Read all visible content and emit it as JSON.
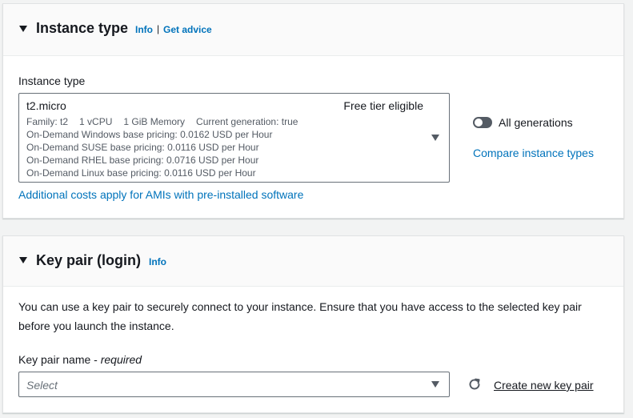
{
  "instance_type_section": {
    "title": "Instance type",
    "info_label": "Info",
    "separator": "|",
    "get_advice_label": "Get advice",
    "field_label": "Instance type",
    "selected": {
      "name": "t2.micro",
      "badge": "Free tier eligible",
      "family": "Family: t2",
      "vcpu": "1 vCPU",
      "memory": "1 GiB Memory",
      "generation": "Current generation: true",
      "pricing": [
        "On-Demand Windows base pricing: 0.0162 USD per Hour",
        "On-Demand SUSE base pricing: 0.0116 USD per Hour",
        "On-Demand RHEL base pricing: 0.0716 USD per Hour",
        "On-Demand Linux base pricing: 0.0116 USD per Hour"
      ]
    },
    "all_generations_label": "All generations",
    "all_generations_enabled": false,
    "compare_label": "Compare instance types",
    "additional_costs_label": "Additional costs apply for AMIs with pre-installed software"
  },
  "key_pair_section": {
    "title": "Key pair (login)",
    "info_label": "Info",
    "description": "You can use a key pair to securely connect to your instance. Ensure that you have access to the selected key pair before you launch the instance.",
    "field_label": "Key pair name - ",
    "field_required": "required",
    "select_placeholder": "Select",
    "create_label": "Create new key pair"
  },
  "colors": {
    "link": "#0073bb",
    "text": "#16191f",
    "muted": "#545b64",
    "toggle_off": "#545b64"
  }
}
